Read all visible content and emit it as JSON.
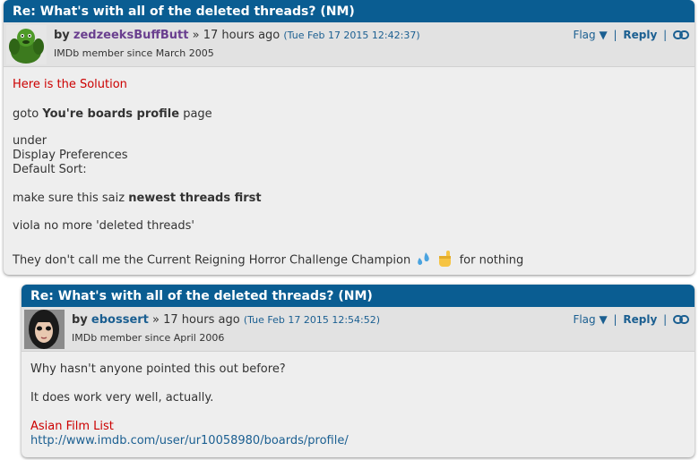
{
  "posts": [
    {
      "title": "Re: What's with all of the deleted threads? (NM)",
      "by_label": "by",
      "username": "zedzeeksBuffButt",
      "username_color": "#6a3f8f",
      "age": "» 17 hours ago",
      "timestamp": "(Tue Feb 17 2015 12:42:37)",
      "member_since": "IMDb member since March 2005",
      "actions": {
        "flag": "Flag ▼",
        "sep": "|",
        "reply": "Reply",
        "permalink_icon": "link-icon"
      },
      "body": {
        "line1": "Here is the Solution",
        "line2_pre": "goto ",
        "line2_bold": "You're boards profile",
        "line2_post": " page",
        "line3": "under",
        "line4": "Display Preferences",
        "line5": "Default Sort:",
        "line6_pre": "make sure this saiz ",
        "line6_bold": "newest threads first",
        "line7": "viola no more 'deleted threads'",
        "line8_pre": "They don't call me the Current Reigning Horror Challenge Champion ",
        "line8_post": " for nothing"
      }
    },
    {
      "title": "Re: What's with all of the deleted threads? (NM)",
      "by_label": "by",
      "username": "ebossert",
      "username_color": "#1b5f91",
      "age": "» 17 hours ago",
      "timestamp": "(Tue Feb 17 2015 12:54:52)",
      "member_since": "IMDb member since April 2006",
      "actions": {
        "flag": "Flag ▼",
        "sep": "|",
        "reply": "Reply",
        "permalink_icon": "link-icon"
      },
      "body": {
        "line1": "Why hasn't anyone pointed this out before?",
        "line2": "It does work very well, actually.",
        "line3": "Asian Film List",
        "line4": "http://www.imdb.com/user/ur10058980/boards/profile/"
      }
    }
  ]
}
